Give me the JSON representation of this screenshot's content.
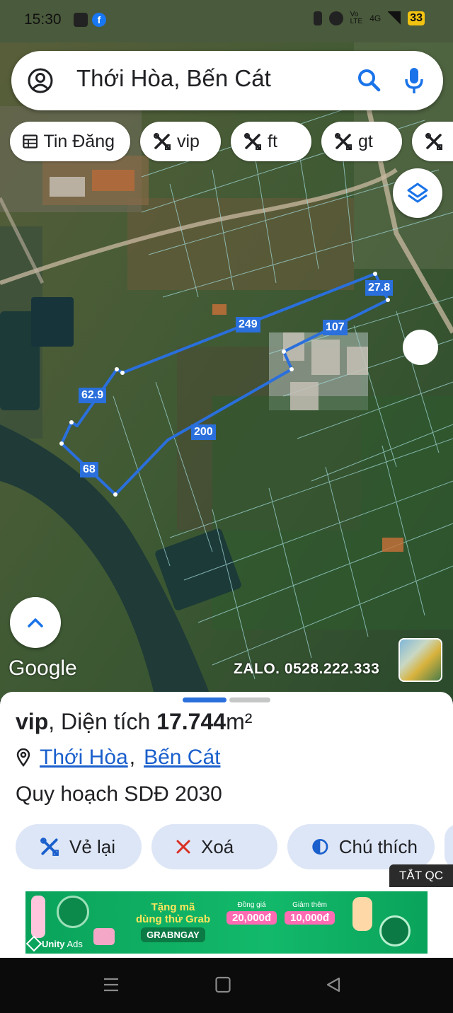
{
  "status_bar": {
    "time": "15:30",
    "battery": "33",
    "network": "4G"
  },
  "search": {
    "text": "Thới Hòa, Bến Cát"
  },
  "chips": [
    {
      "label": "Tin Đăng",
      "icon": "table-icon"
    },
    {
      "label": "vip",
      "icon": "tools-icon"
    },
    {
      "label": "ft",
      "icon": "tools-icon"
    },
    {
      "label": "gt",
      "icon": "tools-icon"
    },
    {
      "label": "",
      "icon": "tools-icon"
    }
  ],
  "map": {
    "edge_labels": [
      "249",
      "27.8",
      "107",
      "62.9",
      "200",
      "68"
    ],
    "watermark": "Google",
    "contact": "ZALO. 0528.222.333"
  },
  "sheet": {
    "category": "vip",
    "area_label": ", Diện tích ",
    "area_value": "17.744",
    "area_unit": "m²",
    "location_parts": [
      "Thới Hòa",
      "Bến Cát"
    ],
    "location_sep": ",",
    "plan": "Quy hoạch SDĐ 2030",
    "actions": [
      {
        "label": "Vẻ lại",
        "icon": "tools-icon"
      },
      {
        "label": "Xoá",
        "icon": "close-icon"
      },
      {
        "label": "Chú thích",
        "icon": "contrast-icon"
      }
    ]
  },
  "ad": {
    "badge": "TẮT QC",
    "headline_1": "Tặng mã",
    "headline_2": "dùng thử Grab",
    "code": "GRABNGAY",
    "promo_1_title": "Đồng giá",
    "promo_1_value": "20,000đ",
    "promo_2_title": "Giảm thêm",
    "promo_2_value": "10,000đ",
    "network": "Unity",
    "network_suffix": "Ads"
  },
  "colors": {
    "accent": "#2a6fdc",
    "chip_bg": "#ffffff",
    "action_bg": "#dde6f6",
    "ad_green": "#13b96a"
  }
}
